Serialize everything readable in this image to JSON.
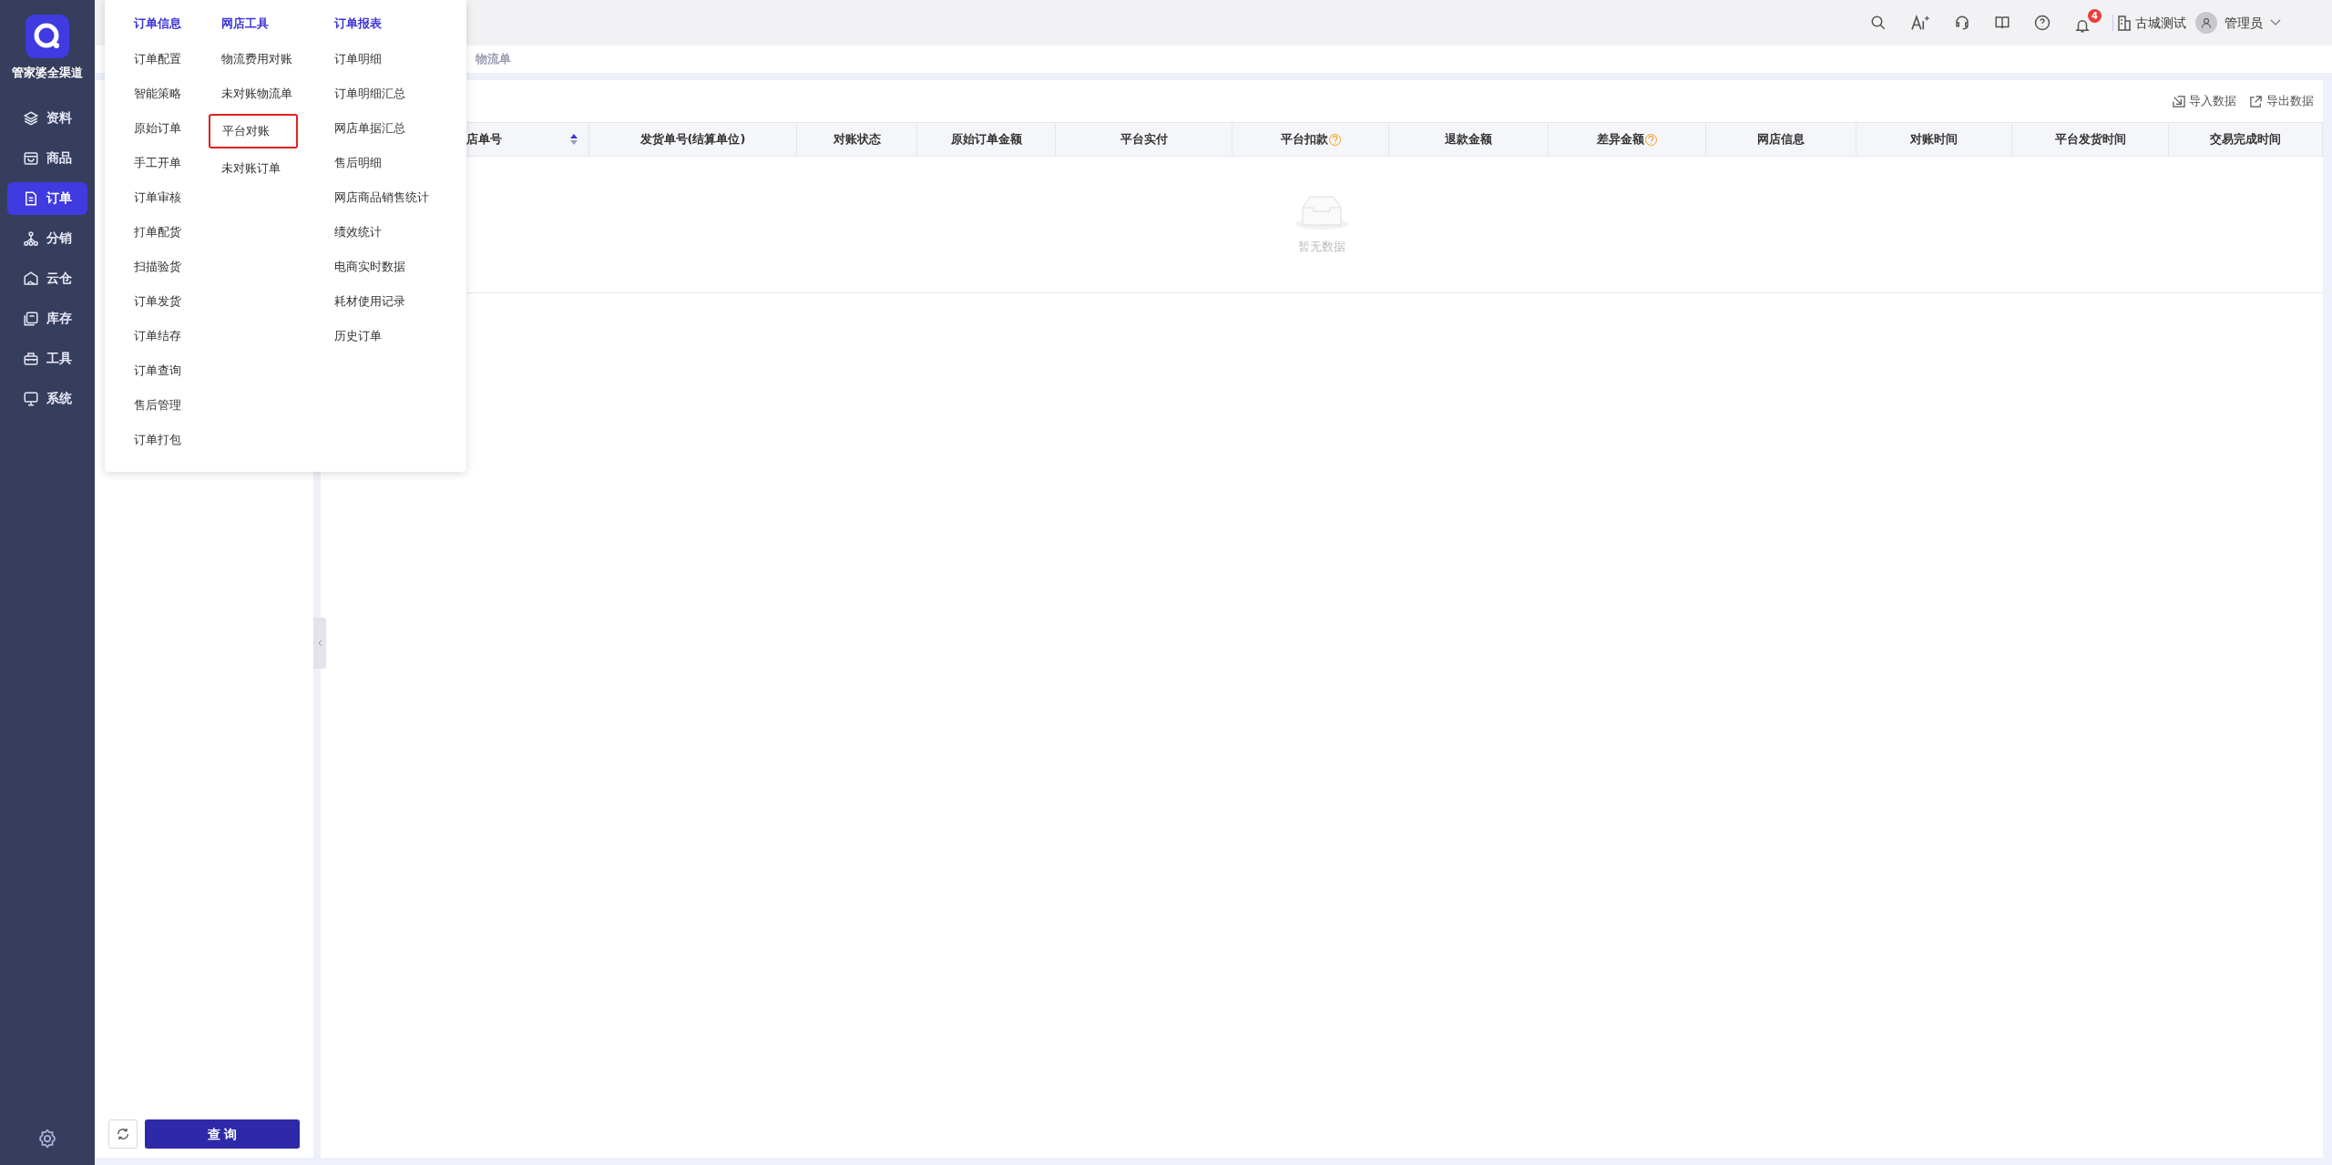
{
  "brand": {
    "name": "管家婆全渠道"
  },
  "nav": [
    {
      "label": "资料",
      "selected": false
    },
    {
      "label": "商品",
      "selected": false
    },
    {
      "label": "订单",
      "selected": true
    },
    {
      "label": "分销",
      "selected": false
    },
    {
      "label": "云仓",
      "selected": false
    },
    {
      "label": "库存",
      "selected": false
    },
    {
      "label": "工具",
      "selected": false
    },
    {
      "label": "系统",
      "selected": false
    }
  ],
  "topbar": {
    "notifications": "4",
    "store": "古城测试",
    "user": "管理员"
  },
  "breadcrumb": "物流单",
  "menu": [
    {
      "title": "订单信息",
      "items": [
        {
          "label": "订单配置",
          "selected": false
        },
        {
          "label": "智能策略",
          "selected": false
        },
        {
          "label": "原始订单",
          "selected": false
        },
        {
          "label": "手工开单",
          "selected": false
        },
        {
          "label": "订单审核",
          "selected": false
        },
        {
          "label": "打单配货",
          "selected": false
        },
        {
          "label": "扫描验货",
          "selected": false
        },
        {
          "label": "订单发货",
          "selected": false
        },
        {
          "label": "订单结存",
          "selected": false
        },
        {
          "label": "订单查询",
          "selected": false
        },
        {
          "label": "售后管理",
          "selected": false
        },
        {
          "label": "订单打包",
          "selected": false
        }
      ]
    },
    {
      "title": "网店工具",
      "items": [
        {
          "label": "物流费用对账",
          "selected": false
        },
        {
          "label": "未对账物流单",
          "selected": false
        },
        {
          "label": "平台对账",
          "selected": true
        },
        {
          "label": "未对账订单",
          "selected": false
        }
      ]
    },
    {
      "title": "订单报表",
      "items": [
        {
          "label": "订单明细",
          "selected": false
        },
        {
          "label": "订单明细汇总",
          "selected": false
        },
        {
          "label": "网店单据汇总",
          "selected": false
        },
        {
          "label": "售后明细",
          "selected": false
        },
        {
          "label": "网店商品销售统计",
          "selected": false
        },
        {
          "label": "绩效统计",
          "selected": false
        },
        {
          "label": "电商实时数据",
          "selected": false
        },
        {
          "label": "耗材使用记录",
          "selected": false
        },
        {
          "label": "历史订单",
          "selected": false
        }
      ]
    }
  ],
  "actions": [
    "导入数据",
    "导出数据"
  ],
  "table": {
    "columns": [
      {
        "label": "店单号",
        "sortable": true,
        "help": false
      },
      {
        "label": "发货单号(结算单位)",
        "sortable": false,
        "help": false
      },
      {
        "label": "对账状态",
        "sortable": false,
        "help": false
      },
      {
        "label": "原始订单金额",
        "sortable": false,
        "help": false
      },
      {
        "label": "平台实付",
        "sortable": false,
        "help": false
      },
      {
        "label": "平台扣款",
        "sortable": false,
        "help": true
      },
      {
        "label": "退款金额",
        "sortable": false,
        "help": false
      },
      {
        "label": "差异金额",
        "sortable": false,
        "help": true
      },
      {
        "label": "网店信息",
        "sortable": false,
        "help": false
      },
      {
        "label": "对账时间",
        "sortable": false,
        "help": false
      },
      {
        "label": "平台发货时间",
        "sortable": false,
        "help": false
      },
      {
        "label": "交易完成时间",
        "sortable": false,
        "help": false
      }
    ],
    "empty": "暂无数据"
  },
  "query_button": "查 询"
}
